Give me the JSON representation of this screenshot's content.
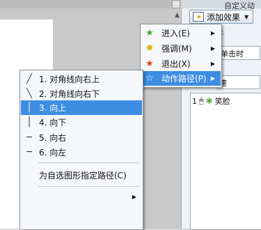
{
  "panel": {
    "title": "自定义动",
    "add_effect": "添加效果",
    "field_start": "单击时",
    "field_speed": "速",
    "list_item_number": "1",
    "list_item_text": "笑脸"
  },
  "main_menu": {
    "items": [
      {
        "label": "进入(E)",
        "icon": "enter-star-icon"
      },
      {
        "label": "强调(M)",
        "icon": "emphasis-star-icon"
      },
      {
        "label": "退出(X)",
        "icon": "exit-star-icon"
      },
      {
        "label": "动作路径(P)",
        "icon": "motion-path-star-icon",
        "selected": true
      }
    ]
  },
  "sub_menu": {
    "items": [
      {
        "glyph": "╱",
        "label": "1. 对角线向右上"
      },
      {
        "glyph": "╲",
        "label": "2. 对角线向右下"
      },
      {
        "glyph": "│",
        "label": "3. 向上",
        "selected": true
      },
      {
        "glyph": "│",
        "label": "4. 向下"
      },
      {
        "glyph": "─",
        "label": "5. 向右"
      },
      {
        "glyph": "─",
        "label": "6. 向左"
      },
      {
        "glyph": "",
        "label": "为自选图形指定路径(C)"
      },
      {
        "glyph": "",
        "label": ""
      }
    ]
  }
}
